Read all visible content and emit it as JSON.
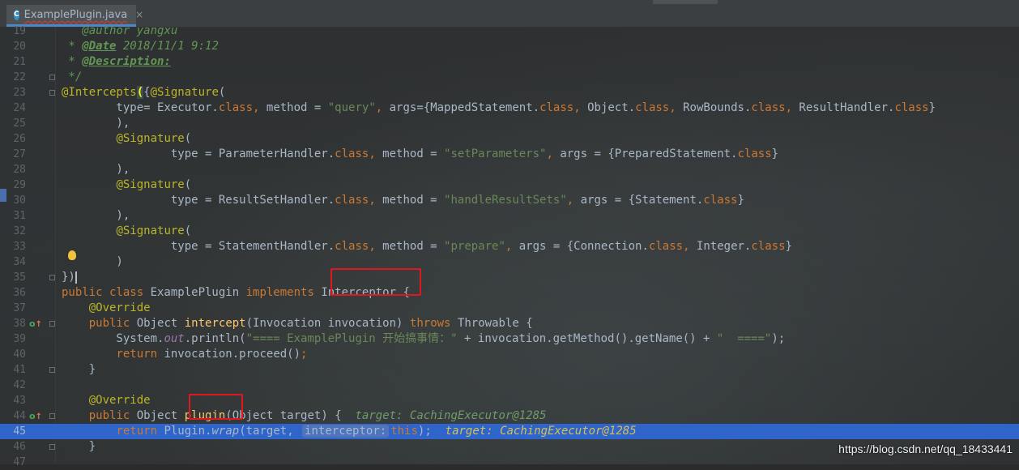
{
  "tab": {
    "label": "ExamplePlugin.java",
    "icon_letter": "C",
    "close": "×"
  },
  "watermark": "https://blog.csdn.net/qq_18433441",
  "lines": [
    {
      "n": "19",
      "segs": [
        {
          "t": "   ",
          "c": ""
        },
        {
          "t": "@author yangxu",
          "c": "doc"
        }
      ]
    },
    {
      "n": "20",
      "segs": [
        {
          "t": " * ",
          "c": "doc"
        },
        {
          "t": "@Date",
          "c": "doctag"
        },
        {
          "t": " 2018/11/1 9:12",
          "c": "doc"
        }
      ]
    },
    {
      "n": "21",
      "segs": [
        {
          "t": " * ",
          "c": "doc"
        },
        {
          "t": "@Description:",
          "c": "doctag"
        }
      ]
    },
    {
      "n": "22",
      "segs": [
        {
          "t": " */",
          "c": "doc"
        }
      ]
    },
    {
      "n": "23",
      "segs": [
        {
          "t": "@Intercepts",
          "c": "an"
        },
        {
          "t": "(",
          "c": "brace-hl"
        },
        {
          "t": "{",
          "c": ""
        },
        {
          "t": "@Signature",
          "c": "an"
        },
        {
          "t": "(",
          "c": ""
        }
      ]
    },
    {
      "n": "24",
      "segs": [
        {
          "t": "        type= Executor.",
          "c": ""
        },
        {
          "t": "class",
          "c": "kw"
        },
        {
          "t": ", ",
          "c": "kw"
        },
        {
          "t": "method = ",
          "c": ""
        },
        {
          "t": "\"query\"",
          "c": "str"
        },
        {
          "t": ", ",
          "c": "kw"
        },
        {
          "t": "args={MappedStatement.",
          "c": ""
        },
        {
          "t": "class",
          "c": "kw"
        },
        {
          "t": ", ",
          "c": "kw"
        },
        {
          "t": "Object.",
          "c": ""
        },
        {
          "t": "class",
          "c": "kw"
        },
        {
          "t": ", ",
          "c": "kw"
        },
        {
          "t": "RowBounds.",
          "c": ""
        },
        {
          "t": "class",
          "c": "kw"
        },
        {
          "t": ", ",
          "c": "kw"
        },
        {
          "t": "ResultHandler.",
          "c": ""
        },
        {
          "t": "class",
          "c": "kw"
        },
        {
          "t": "}",
          "c": ""
        }
      ]
    },
    {
      "n": "25",
      "segs": [
        {
          "t": "        ),",
          "c": ""
        }
      ]
    },
    {
      "n": "26",
      "segs": [
        {
          "t": "        ",
          "c": ""
        },
        {
          "t": "@Signature",
          "c": "an"
        },
        {
          "t": "(",
          "c": ""
        }
      ]
    },
    {
      "n": "27",
      "segs": [
        {
          "t": "                type = ParameterHandler.",
          "c": ""
        },
        {
          "t": "class",
          "c": "kw"
        },
        {
          "t": ", ",
          "c": "kw"
        },
        {
          "t": "method = ",
          "c": ""
        },
        {
          "t": "\"setParameters\"",
          "c": "str"
        },
        {
          "t": ", ",
          "c": "kw"
        },
        {
          "t": "args = {PreparedStatement.",
          "c": ""
        },
        {
          "t": "class",
          "c": "kw"
        },
        {
          "t": "}",
          "c": ""
        }
      ]
    },
    {
      "n": "28",
      "segs": [
        {
          "t": "        ),",
          "c": ""
        }
      ]
    },
    {
      "n": "29",
      "segs": [
        {
          "t": "        ",
          "c": ""
        },
        {
          "t": "@Signature",
          "c": "an"
        },
        {
          "t": "(",
          "c": ""
        }
      ]
    },
    {
      "n": "30",
      "segs": [
        {
          "t": "                type = ResultSetHandler.",
          "c": ""
        },
        {
          "t": "class",
          "c": "kw"
        },
        {
          "t": ", ",
          "c": "kw"
        },
        {
          "t": "method = ",
          "c": ""
        },
        {
          "t": "\"handleResultSets\"",
          "c": "str"
        },
        {
          "t": ", ",
          "c": "kw"
        },
        {
          "t": "args = {Statement.",
          "c": ""
        },
        {
          "t": "class",
          "c": "kw"
        },
        {
          "t": "}",
          "c": ""
        }
      ]
    },
    {
      "n": "31",
      "segs": [
        {
          "t": "        ),",
          "c": ""
        }
      ]
    },
    {
      "n": "32",
      "segs": [
        {
          "t": "        ",
          "c": ""
        },
        {
          "t": "@Signature",
          "c": "an"
        },
        {
          "t": "(",
          "c": ""
        }
      ]
    },
    {
      "n": "33",
      "segs": [
        {
          "t": "                type = StatementHandler.",
          "c": ""
        },
        {
          "t": "class",
          "c": "kw"
        },
        {
          "t": ", ",
          "c": "kw"
        },
        {
          "t": "method = ",
          "c": ""
        },
        {
          "t": "\"prepare\"",
          "c": "str"
        },
        {
          "t": ", ",
          "c": "kw"
        },
        {
          "t": "args = {Connection.",
          "c": ""
        },
        {
          "t": "class",
          "c": "kw"
        },
        {
          "t": ", ",
          "c": "kw"
        },
        {
          "t": "Integer.",
          "c": ""
        },
        {
          "t": "class",
          "c": "kw"
        },
        {
          "t": "}",
          "c": ""
        }
      ]
    },
    {
      "n": "34",
      "segs": [
        {
          "t": "        )",
          "c": ""
        }
      ]
    },
    {
      "n": "35",
      "segs": [
        {
          "t": "})",
          "c": ""
        },
        {
          "t": "",
          "c": "caret"
        }
      ]
    },
    {
      "n": "36",
      "segs": [
        {
          "t": "public class ",
          "c": "kw"
        },
        {
          "t": "ExamplePlugin ",
          "c": ""
        },
        {
          "t": "implements ",
          "c": "kw"
        },
        {
          "t": "Interceptor {",
          "c": ""
        }
      ]
    },
    {
      "n": "37",
      "segs": [
        {
          "t": "    ",
          "c": ""
        },
        {
          "t": "@Override",
          "c": "an"
        }
      ]
    },
    {
      "n": "38",
      "segs": [
        {
          "t": "    ",
          "c": ""
        },
        {
          "t": "public ",
          "c": "kw"
        },
        {
          "t": "Object ",
          "c": ""
        },
        {
          "t": "intercept",
          "c": "fn"
        },
        {
          "t": "(Invocation invocation) ",
          "c": ""
        },
        {
          "t": "throws ",
          "c": "kw"
        },
        {
          "t": "Throwable {",
          "c": ""
        }
      ]
    },
    {
      "n": "39",
      "segs": [
        {
          "t": "        System.",
          "c": ""
        },
        {
          "t": "out",
          "c": "field"
        },
        {
          "t": ".println(",
          "c": ""
        },
        {
          "t": "\"==== ExamplePlugin 开始搞事情：\"",
          "c": "str"
        },
        {
          "t": " + invocation.getMethod().getName() + ",
          "c": ""
        },
        {
          "t": "\"  ====\"",
          "c": "str"
        },
        {
          "t": ");",
          "c": ""
        }
      ]
    },
    {
      "n": "40",
      "segs": [
        {
          "t": "        ",
          "c": ""
        },
        {
          "t": "return ",
          "c": "kw"
        },
        {
          "t": "invocation.proceed()",
          "c": ""
        },
        {
          "t": ";",
          "c": "kw"
        }
      ]
    },
    {
      "n": "41",
      "segs": [
        {
          "t": "    }",
          "c": ""
        }
      ]
    },
    {
      "n": "42",
      "segs": []
    },
    {
      "n": "43",
      "segs": [
        {
          "t": "    ",
          "c": ""
        },
        {
          "t": "@Override",
          "c": "an"
        }
      ]
    },
    {
      "n": "44",
      "segs": [
        {
          "t": "    ",
          "c": ""
        },
        {
          "t": "public ",
          "c": "kw"
        },
        {
          "t": "Object ",
          "c": ""
        },
        {
          "t": "plugin",
          "c": "fn"
        },
        {
          "t": "(Object target) {  ",
          "c": ""
        },
        {
          "t": "target: CachingExecutor@1285",
          "c": "inline-val-dim"
        }
      ]
    },
    {
      "n": "45",
      "exec": true,
      "segs": [
        {
          "t": "        ",
          "c": ""
        },
        {
          "t": "return ",
          "c": "kw"
        },
        {
          "t": "Plugin.",
          "c": ""
        },
        {
          "t": "wrap",
          "c": "it"
        },
        {
          "t": "(target, ",
          "c": ""
        },
        {
          "t": "interceptor:",
          "c": "hint"
        },
        {
          "t": "this",
          "c": "kw"
        },
        {
          "t": ");  ",
          "c": ""
        },
        {
          "t": "target: CachingExecutor@1285",
          "c": "inline-val"
        }
      ]
    },
    {
      "n": "46",
      "segs": [
        {
          "t": "    }",
          "c": ""
        }
      ]
    },
    {
      "n": "47",
      "segs": []
    }
  ]
}
